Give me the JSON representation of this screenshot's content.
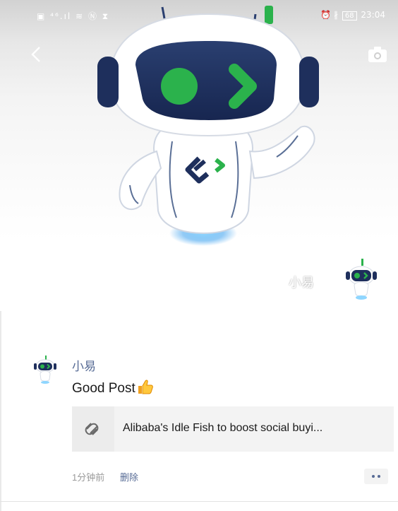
{
  "status_bar": {
    "left_icons": "▣ ⁴⁶.ıl ≋ Ⓝ ⧗",
    "right_icons": "⏰ ∦",
    "battery": "68",
    "time": "23:04"
  },
  "cover": {
    "user_name": "小易"
  },
  "post": {
    "author": "小易",
    "text": "Good Post",
    "link_title": "Alibaba's Idle Fish to boost social buyi...",
    "time": "1分钟前",
    "delete_label": "删除"
  },
  "icons": {
    "back": "chevron-left-icon",
    "camera": "camera-icon",
    "link": "link-icon",
    "thumbs_up": "thumbs-up-icon",
    "more": "more-dots-icon"
  },
  "colors": {
    "name_link": "#576b95",
    "mascot_green": "#1fb14a",
    "mascot_navy": "#1e2f5c"
  }
}
